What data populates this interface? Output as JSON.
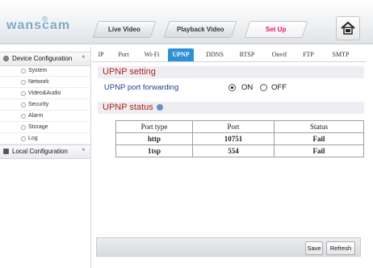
{
  "app": {
    "logo_text": "wanscam",
    "logo_mark": "®"
  },
  "nav": {
    "tabs": [
      {
        "label": "Live Video",
        "active": false
      },
      {
        "label": "Playback Video",
        "active": false
      },
      {
        "label": "Set Up",
        "active": true
      }
    ],
    "home_icon": "home-icon",
    "active_color": "#e2136b"
  },
  "sidebar": {
    "device_config": {
      "label": "Device Configuration",
      "caret": "^"
    },
    "items": [
      {
        "label": "System"
      },
      {
        "label": "Network"
      },
      {
        "label": "Video&Audio"
      },
      {
        "label": "Security"
      },
      {
        "label": "Alarm"
      },
      {
        "label": "Storage"
      },
      {
        "label": "Log"
      }
    ],
    "local_config": {
      "label": "Local Configuration",
      "caret": "^"
    }
  },
  "subtabs": [
    {
      "label": "IP"
    },
    {
      "label": "Port"
    },
    {
      "label": "Wi-Fi"
    },
    {
      "label": "UPNP",
      "active": true
    },
    {
      "label": "DDNS"
    },
    {
      "label": "RTSP"
    },
    {
      "label": "Onvif"
    },
    {
      "label": "FTP"
    },
    {
      "label": "SMTP"
    }
  ],
  "upnp": {
    "setting_title": "UPNP setting",
    "forwarding_label": "UPNP port forwarding",
    "on_label": "ON",
    "off_label": "OFF",
    "selected": "ON",
    "status_title": "UPNP status",
    "table": {
      "headers": [
        "Port type",
        "Port",
        "Status"
      ],
      "rows": [
        [
          "http",
          "10751",
          "Fail"
        ],
        [
          "1tsp",
          "554",
          "Fail"
        ]
      ]
    }
  },
  "buttons": {
    "save": "Save",
    "refresh": "Refresh"
  },
  "colors": {
    "accent": "#2e90d7",
    "section_title": "#b22222",
    "label_blue": "#1d3f8f"
  }
}
